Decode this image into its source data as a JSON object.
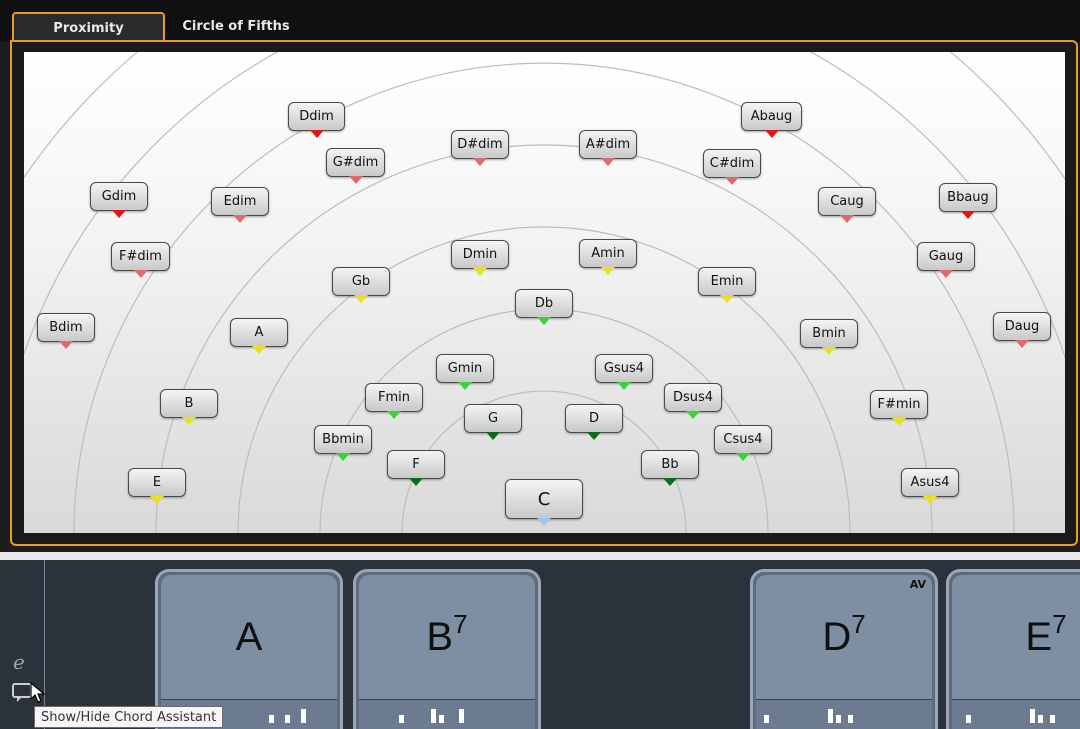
{
  "tabs": [
    {
      "label": "Proximity",
      "active": true
    },
    {
      "label": "Circle of Fifths",
      "active": false
    }
  ],
  "proximity": {
    "center": {
      "label": "C",
      "arrow_color": "#9cc8f0"
    },
    "chords": [
      {
        "label": "Ddim",
        "arrow": "#e01515"
      },
      {
        "label": "Abaug",
        "arrow": "#e01515"
      },
      {
        "label": "D#dim",
        "arrow": "#e06a6a"
      },
      {
        "label": "A#dim",
        "arrow": "#e06a6a"
      },
      {
        "label": "G#dim",
        "arrow": "#e06a6a"
      },
      {
        "label": "C#dim",
        "arrow": "#e06a6a"
      },
      {
        "label": "Gdim",
        "arrow": "#e01515"
      },
      {
        "label": "Edim",
        "arrow": "#e06a6a"
      },
      {
        "label": "Caug",
        "arrow": "#e06a6a"
      },
      {
        "label": "Bbaug",
        "arrow": "#e01515"
      },
      {
        "label": "F#dim",
        "arrow": "#e06a6a"
      },
      {
        "label": "Dmin",
        "arrow": "#e8e020"
      },
      {
        "label": "Amin",
        "arrow": "#e8e020"
      },
      {
        "label": "Gaug",
        "arrow": "#e06a6a"
      },
      {
        "label": "Gb",
        "arrow": "#e8e020"
      },
      {
        "label": "Emin",
        "arrow": "#e8e020"
      },
      {
        "label": "Db",
        "arrow": "#3ad43a"
      },
      {
        "label": "Bdim",
        "arrow": "#e06a6a"
      },
      {
        "label": "A",
        "arrow": "#e8e020"
      },
      {
        "label": "Bmin",
        "arrow": "#e8e020"
      },
      {
        "label": "Daug",
        "arrow": "#e06a6a"
      },
      {
        "label": "Gmin",
        "arrow": "#3ad43a"
      },
      {
        "label": "Gsus4",
        "arrow": "#3ad43a"
      },
      {
        "label": "Fmin",
        "arrow": "#3ad43a"
      },
      {
        "label": "Dsus4",
        "arrow": "#3ad43a"
      },
      {
        "label": "B",
        "arrow": "#e8e020"
      },
      {
        "label": "F#min",
        "arrow": "#e8e020"
      },
      {
        "label": "G",
        "arrow": "#0f6a1c"
      },
      {
        "label": "D",
        "arrow": "#0f6a1c"
      },
      {
        "label": "Bbmin",
        "arrow": "#3ad43a"
      },
      {
        "label": "Csus4",
        "arrow": "#3ad43a"
      },
      {
        "label": "F",
        "arrow": "#0f6a1c"
      },
      {
        "label": "Bb",
        "arrow": "#0f6a1c"
      },
      {
        "label": "E",
        "arrow": "#e8e020"
      },
      {
        "label": "Asus4",
        "arrow": "#e8e020"
      }
    ]
  },
  "chord_track": {
    "events": [
      {
        "root": "A",
        "ext": ""
      },
      {
        "root": "B",
        "ext": "7"
      },
      {
        "root": "D",
        "ext": "7",
        "badge": "AV"
      },
      {
        "root": "E",
        "ext": "7"
      }
    ]
  },
  "tooltip": "Show/Hide Chord Assistant",
  "icons": {
    "edit": "e",
    "chord_assistant": "speech-bubble-icon"
  },
  "colors": {
    "accent": "#e79b2a",
    "event_fill": "#7e8ea3",
    "event_border": "#9aa6b6"
  }
}
